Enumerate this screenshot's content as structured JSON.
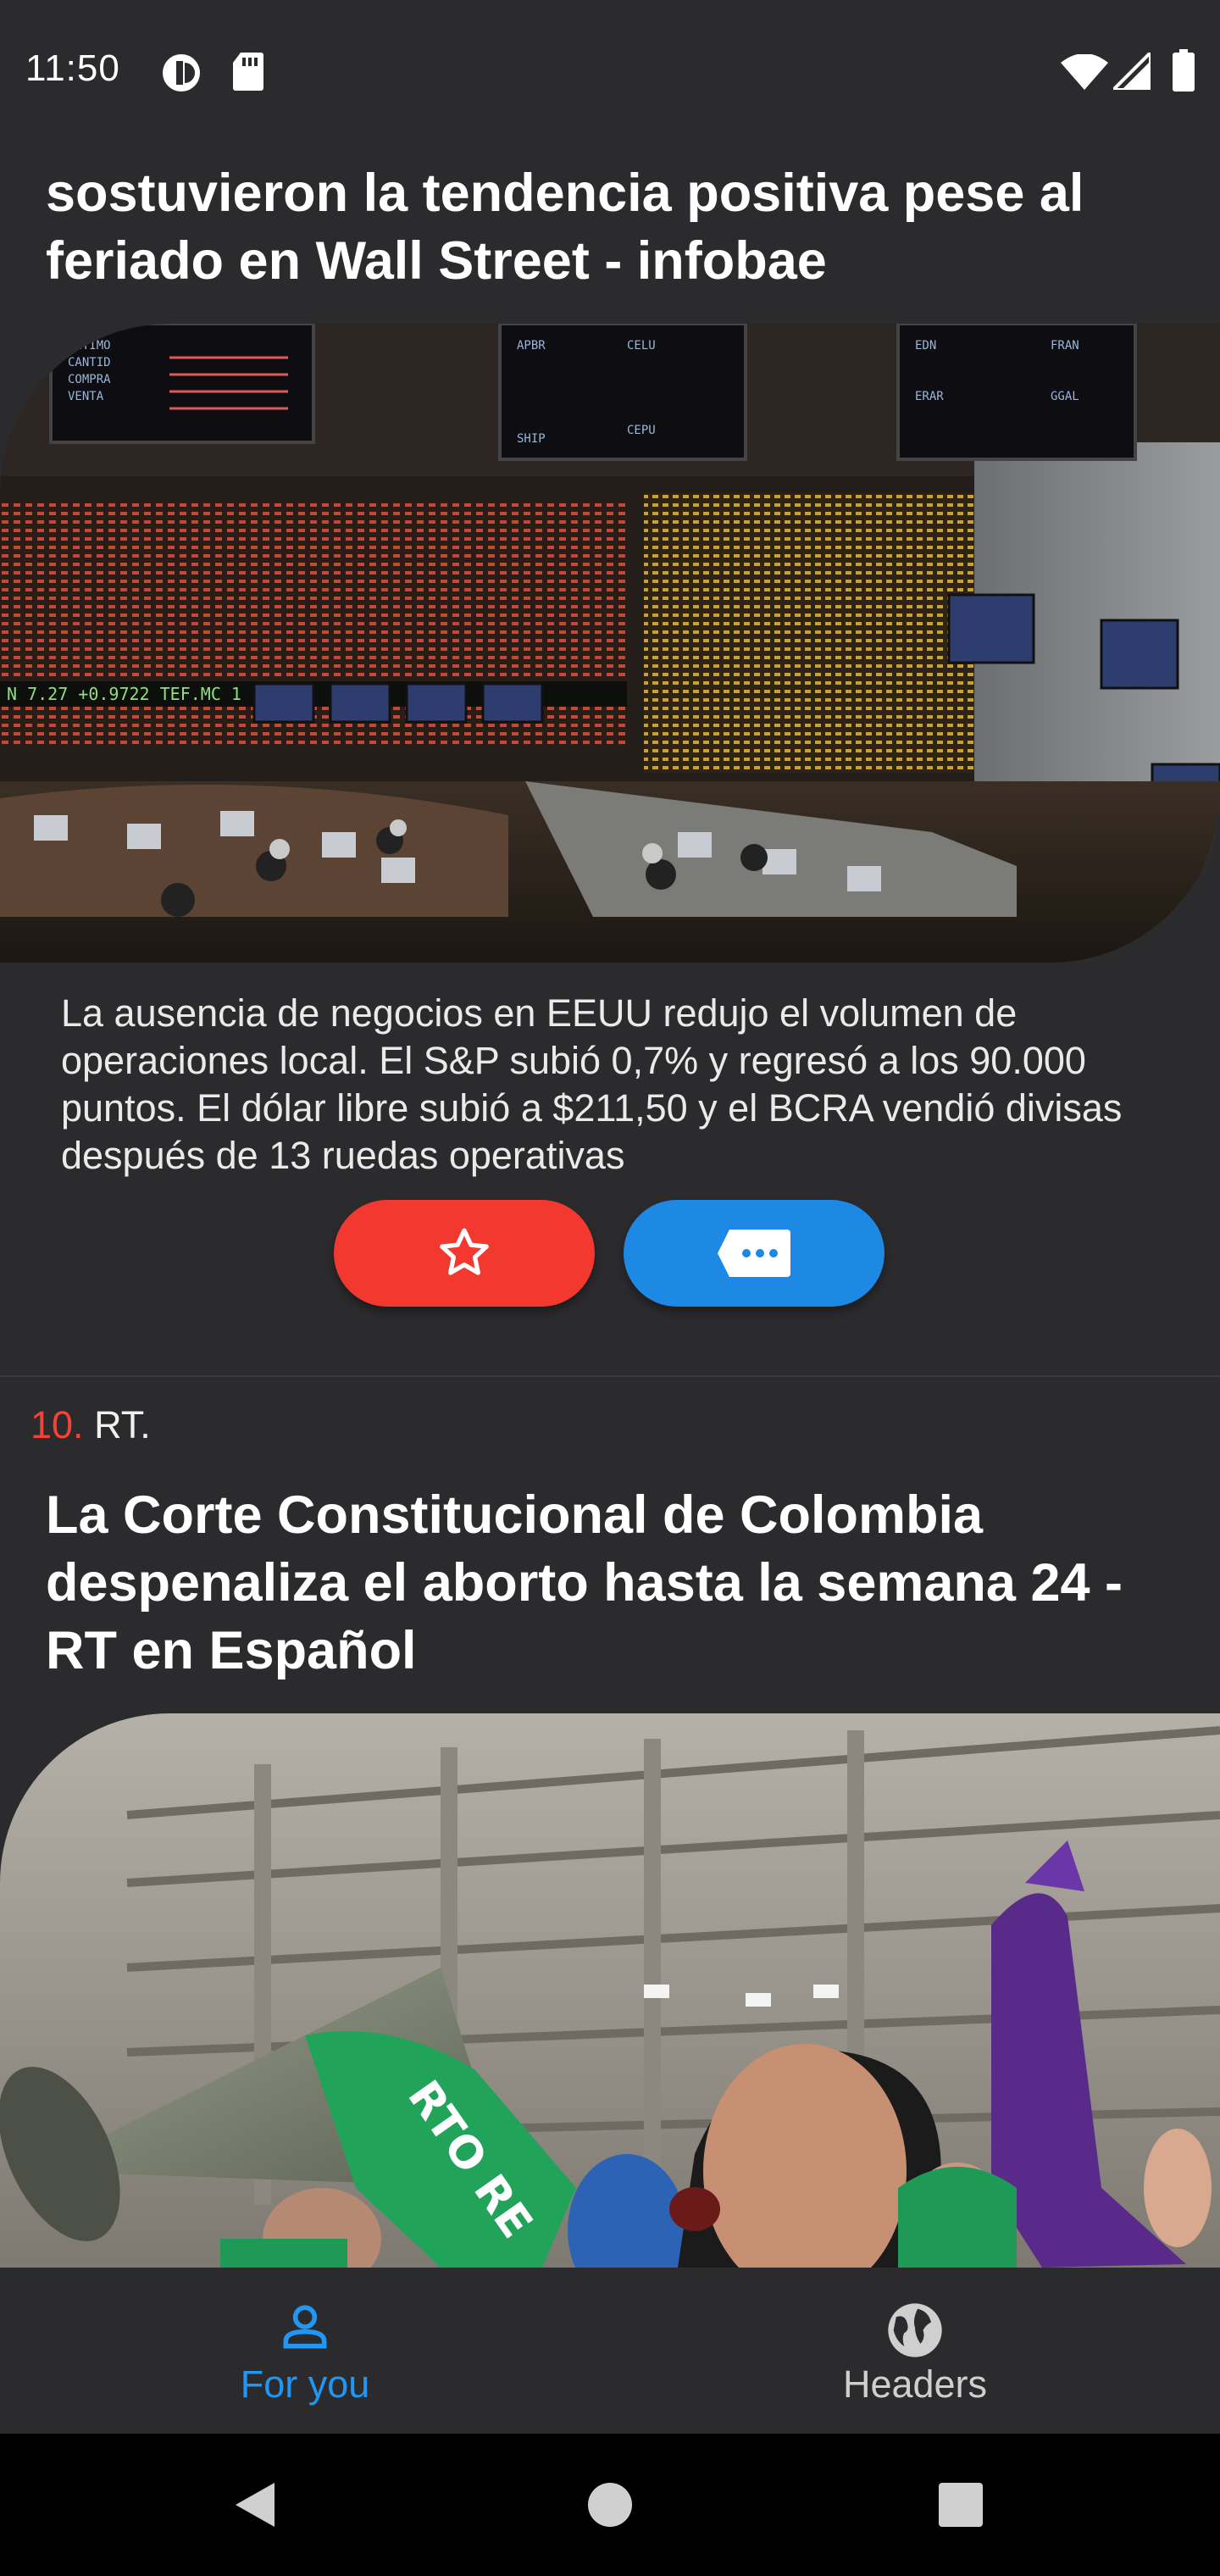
{
  "status_bar": {
    "time": "11:50"
  },
  "article_1": {
    "title": "sostuvieron la tendencia positiva pese al feriado en Wall Street - infobae",
    "summary": "La ausencia de negocios en EEUU redujo el volumen de operaciones local. El S&P subió 0,7% y regresó a los 90.000 puntos. El dólar libre subió a $211,50 y el BCRA vendió divisas después de 13 ruedas operativas",
    "board_text": {
      "ticker": "N 7.27 +0.9722   TEF.MC 1",
      "labels": [
        "ULTIMO",
        "CANTID",
        "COMPRA",
        "VENTA",
        "APBR",
        "CELU",
        "CEPU",
        "EDN",
        "ERAR",
        "FRAN",
        "GGAL",
        "SHIP"
      ]
    }
  },
  "article_2": {
    "rank": "10.",
    "source": "RT.",
    "title": "La Corte Constitucional de Colombia despenaliza el aborto hasta la semana 24 - RT en Español",
    "bandana_text": "RTO RE"
  },
  "bottom_nav": {
    "items": [
      {
        "label": "For you",
        "icon": "person-icon",
        "active": true
      },
      {
        "label": "Headers",
        "icon": "globe-icon",
        "active": false
      }
    ]
  },
  "colors": {
    "background": "#2b2b2d",
    "accent": "#2196f3",
    "favorite": "#f2382f",
    "comment": "#1e88e5",
    "rank": "#f44336"
  }
}
